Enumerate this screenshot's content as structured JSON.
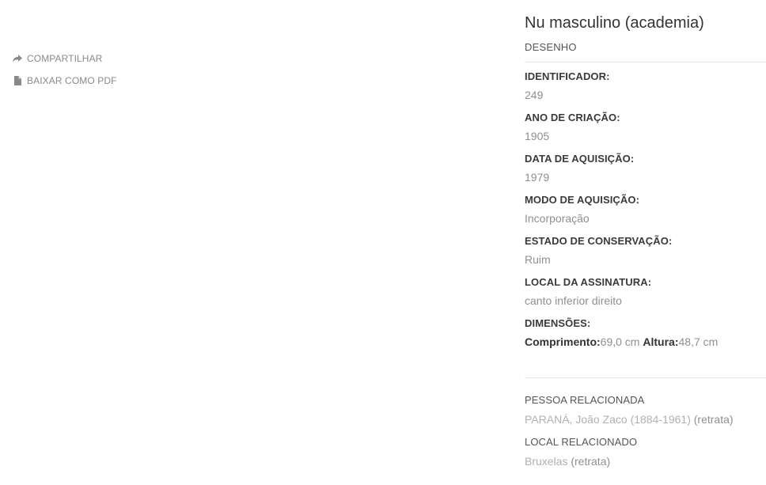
{
  "actions": {
    "share_label": "COMPARTILHAR",
    "pdf_label": "BAIXAR COMO PDF",
    "share_icon": "share-arrow-icon",
    "pdf_icon": "document-icon"
  },
  "artwork": {
    "title": "Nu masculino (academia)",
    "type": "DESENHO"
  },
  "fields": [
    {
      "label": "IDENTIFICADOR:",
      "value": "249"
    },
    {
      "label": "ANO DE CRIAÇÃO:",
      "value": "1905"
    },
    {
      "label": "DATA DE AQUISIÇÃO:",
      "value": "1979"
    },
    {
      "label": "MODO DE AQUISIÇÃO:",
      "value": "Incorporação"
    },
    {
      "label": "ESTADO DE CONSERVAÇÃO:",
      "value": "Ruim"
    },
    {
      "label": "LOCAL DA ASSINATURA:",
      "value": "canto inferior direito"
    }
  ],
  "dimensions": {
    "label": "DIMENSÕES:",
    "length_label": "Comprimento:",
    "length_value": "69,0 cm",
    "height_label": "Altura:",
    "height_value": "48,7 cm"
  },
  "related": {
    "person_label": "PESSOA RELACIONADA",
    "person_name": "PARANÁ, João Zaco (1884-1961)",
    "person_role": "(retrata)",
    "place_label": "LOCAL RELACIONADO",
    "place_name": "Bruxelas",
    "place_role": "(retrata)"
  },
  "colors": {
    "label_text": "#3a3a3a",
    "value_text": "#8f8f8f",
    "link_text": "#b0b0b0",
    "action_text": "#8a8a8a",
    "divider": "#e6e6e6"
  }
}
